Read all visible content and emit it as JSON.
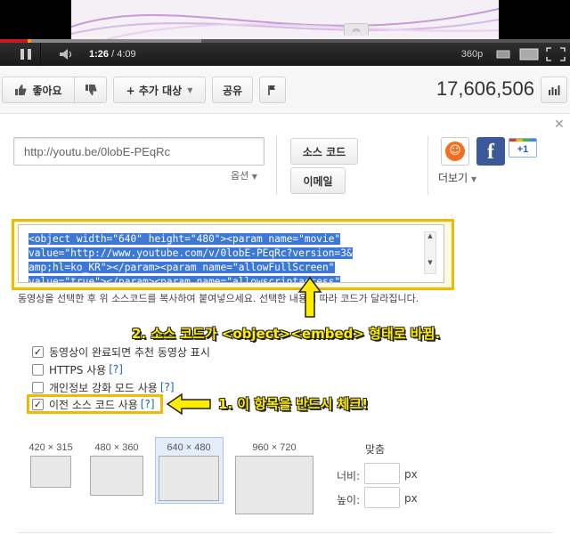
{
  "player": {
    "time_current": "1:26",
    "time_total": "/ 4:09",
    "quality": "360p",
    "progress_fraction": 0.052,
    "buffer_fraction": 0.353
  },
  "actions": {
    "like_label": "좋아요",
    "add_to_label": "+ 추가 대상",
    "share_label": "공유",
    "view_count": "17,606,506"
  },
  "share": {
    "short_url": "http://youtu.be/0lobE-PEqRc",
    "options_label": "옵션",
    "source_code_label": "소스 코드",
    "email_label": "이메일",
    "more_label": "더보기",
    "gplus_label": "+1",
    "facebook_label": "f"
  },
  "embed": {
    "code_lines": [
      "<object width=\"640\" height=\"480\"><param name=\"movie\"",
      "value=\"http://www.youtube.com/v/0lobE-PEqRc?version=3&",
      "amp;hl=ko_KR\"></param><param name=\"allowFullScreen\"",
      "value=\"true\"></param><param name=\"allowscriptaccess\""
    ],
    "help_text": "동영상을 선택한 후 위 소스코드를 복사하여 붙여넣으세요. 선택한 내용에 따라 코드가 달라집니다."
  },
  "annotations": {
    "note_2": "2. 소스 코드가 <object><embed> 형태로 바뀜.",
    "note_1": "1. 이 항목을 반드시 체크!"
  },
  "options": [
    {
      "label": "동영상이 완료되면 추천 동영상 표시",
      "checked": true,
      "help": ""
    },
    {
      "label": "HTTPS 사용",
      "checked": false,
      "help": "[?]"
    },
    {
      "label": "개인정보 강화 모드 사용",
      "checked": false,
      "help": "[?]"
    },
    {
      "label": "이전 소스 코드 사용",
      "checked": true,
      "help": "[?]"
    }
  ],
  "sizes": [
    {
      "label": "420 × 315",
      "selected": false
    },
    {
      "label": "480 × 360",
      "selected": false
    },
    {
      "label": "640 × 480",
      "selected": true
    },
    {
      "label": "960 × 720",
      "selected": false
    }
  ],
  "custom_size": {
    "title": "맞춤",
    "width_label": "너비:",
    "height_label": "높이:",
    "unit": "px"
  },
  "colors": {
    "highlight_outline": "#f2b900",
    "annotation_text": "#ffec00",
    "selection_blue": "#3b78d8",
    "progress_red": "#cc181e"
  }
}
